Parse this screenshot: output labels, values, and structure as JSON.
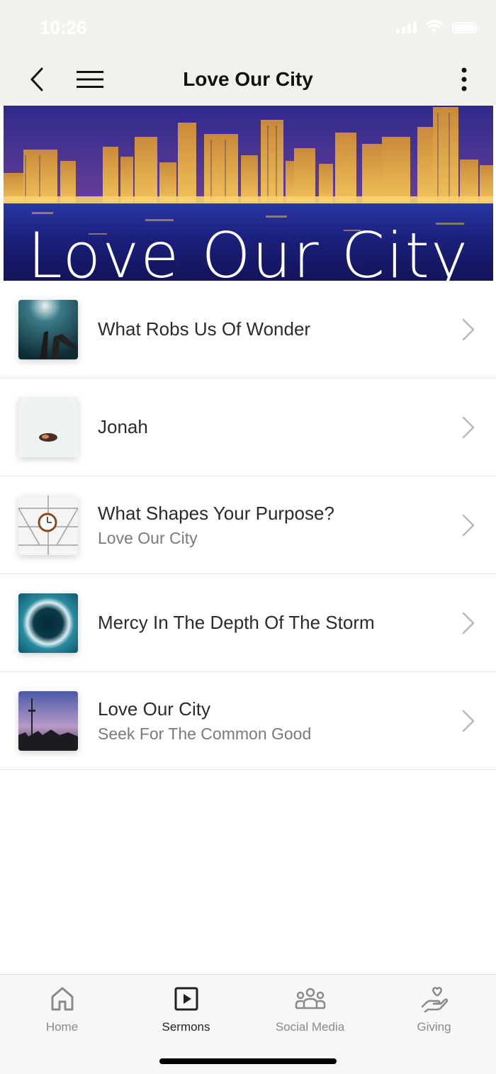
{
  "status": {
    "time": "10:26"
  },
  "header": {
    "title": "Love Our City"
  },
  "banner": {
    "text": "Love Our City"
  },
  "items": [
    {
      "title": "What Robs Us Of Wonder",
      "subtitle": ""
    },
    {
      "title": "Jonah",
      "subtitle": ""
    },
    {
      "title": "What Shapes Your Purpose?",
      "subtitle": "Love Our City"
    },
    {
      "title": "Mercy In The Depth Of The Storm",
      "subtitle": ""
    },
    {
      "title": "Love Our City",
      "subtitle": "Seek For The Common Good"
    }
  ],
  "tabs": [
    {
      "label": "Home",
      "icon": "home-icon",
      "active": false
    },
    {
      "label": "Sermons",
      "icon": "play-square-icon",
      "active": true
    },
    {
      "label": "Social Media",
      "icon": "people-icon",
      "active": false
    },
    {
      "label": "Giving",
      "icon": "giving-hand-icon",
      "active": false
    }
  ],
  "colors": {
    "header_bg": "#f2f2ed",
    "active_tab": "#222222",
    "inactive_tab": "#8a8a8a"
  }
}
